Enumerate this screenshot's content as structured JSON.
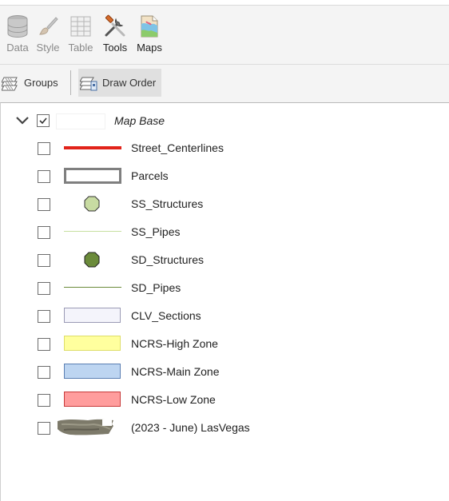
{
  "toolbar": {
    "buttons": [
      {
        "label": "Data",
        "icon": "database-icon",
        "enabled": false
      },
      {
        "label": "Style",
        "icon": "paintbrush-icon",
        "enabled": false
      },
      {
        "label": "Table",
        "icon": "table-icon",
        "enabled": false
      },
      {
        "label": "Tools",
        "icon": "tools-icon",
        "enabled": true
      },
      {
        "label": "Maps",
        "icon": "maps-icon",
        "enabled": true
      }
    ]
  },
  "tabs": [
    {
      "label": "Groups",
      "icon": "layers-icon",
      "active": false
    },
    {
      "label": "Draw Order",
      "icon": "draw-order-icon",
      "active": true
    }
  ],
  "tree": {
    "group": {
      "label": "Map Base",
      "checked": true,
      "expanded": true
    },
    "layers": [
      {
        "label": "Street_Centerlines",
        "symbol": "thick-red-line",
        "checked": false,
        "color": "#e2231a"
      },
      {
        "label": "Parcels",
        "symbol": "gray-outline-rect",
        "checked": false,
        "color": "#7f7f7f"
      },
      {
        "label": "SS_Structures",
        "symbol": "light-green-octagon",
        "checked": false,
        "color": "#c8dba2"
      },
      {
        "label": "SS_Pipes",
        "symbol": "thin-light-green-line",
        "checked": false,
        "color": "#c6dfa0"
      },
      {
        "label": "SD_Structures",
        "symbol": "olive-green-octagon",
        "checked": false,
        "color": "#6b8b3a"
      },
      {
        "label": "SD_Pipes",
        "symbol": "thin-olive-line",
        "checked": false,
        "color": "#6b8b3a"
      },
      {
        "label": "CLV_Sections",
        "symbol": "lavender-rect",
        "checked": false,
        "color": "#f4f4fb"
      },
      {
        "label": "NCRS-High Zone",
        "symbol": "yellow-rect",
        "checked": false,
        "color": "#ffff9e"
      },
      {
        "label": "NCRS-Main Zone",
        "symbol": "blue-rect",
        "checked": false,
        "color": "#bdd5f1"
      },
      {
        "label": "NCRS-Low Zone",
        "symbol": "red-rect",
        "checked": false,
        "color": "#ff9d9d"
      },
      {
        "label": "(2023 - June) LasVegas",
        "symbol": "imagery-thumbnail",
        "checked": false,
        "color": "#7d7a6a"
      }
    ]
  }
}
